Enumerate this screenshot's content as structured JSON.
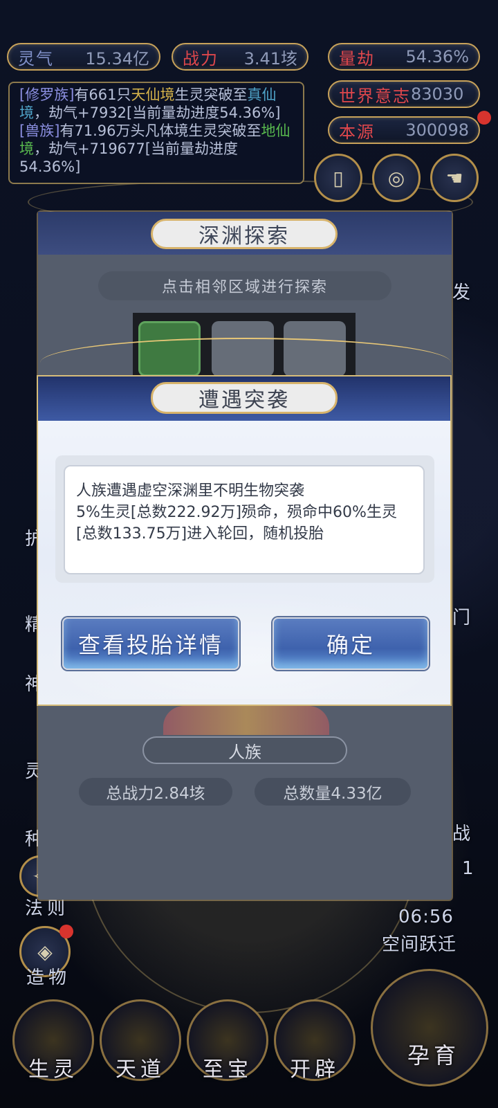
{
  "hud": {
    "lingqi": {
      "label": "灵气",
      "value": "15.34亿"
    },
    "zhanli": {
      "label": "战力",
      "value": "3.41垓"
    },
    "liangjie": {
      "label": "量劫",
      "value": "54.36%"
    },
    "shijie": {
      "label": "世界意志",
      "value": "83030"
    },
    "benyuan": {
      "label": "本源",
      "value": "300098"
    }
  },
  "log": {
    "l1_a": "[修罗族]",
    "l1_b": "有661只",
    "l1_c": "天仙境",
    "l1_d": "生灵突破至",
    "l1_e": "真仙境",
    "l1_f": "，劫气+7932[当前量劫进度54.36%]",
    "l2_a": "[兽族]",
    "l2_b": "有71.96万头凡体境生灵突破至",
    "l2_c": "地仙境",
    "l2_d": "，劫气+719677[当前量劫进度54.36%]"
  },
  "side_left": {
    "fa_ze": "法则",
    "zao_wu": "造物",
    "partial": [
      "护",
      "精",
      "神",
      "灵",
      "种"
    ]
  },
  "side_right": {
    "partial_fa": "发",
    "partial_men": "门",
    "partial_zhan": "战",
    "timer_count": "1",
    "timer": "06:56",
    "kongjian": "空间跃迁"
  },
  "bottom_tabs": [
    "生灵",
    "天道",
    "至宝",
    "开辟"
  ],
  "yun_yu": "孕育",
  "abyss": {
    "title": "深渊探索",
    "hint": "点击相邻区域进行探索",
    "race": "人族",
    "total_power": "总战力2.84垓",
    "total_count": "总数量4.33亿"
  },
  "ambush": {
    "title": "遭遇突袭",
    "line1": "人族遭遇虚空深渊里不明生物突袭",
    "line2": "5%生灵[总数222.92万]殒命，殒命中60%生灵[总数133.75万]进入轮回，随机投胎",
    "btn_details": "查看投胎详情",
    "btn_ok": "确定"
  },
  "colors": {
    "gold": "#c8a25a",
    "red_label": "#e0474c",
    "dialog_header": "#2c3b6a",
    "button_blue": "#3e62ad"
  }
}
